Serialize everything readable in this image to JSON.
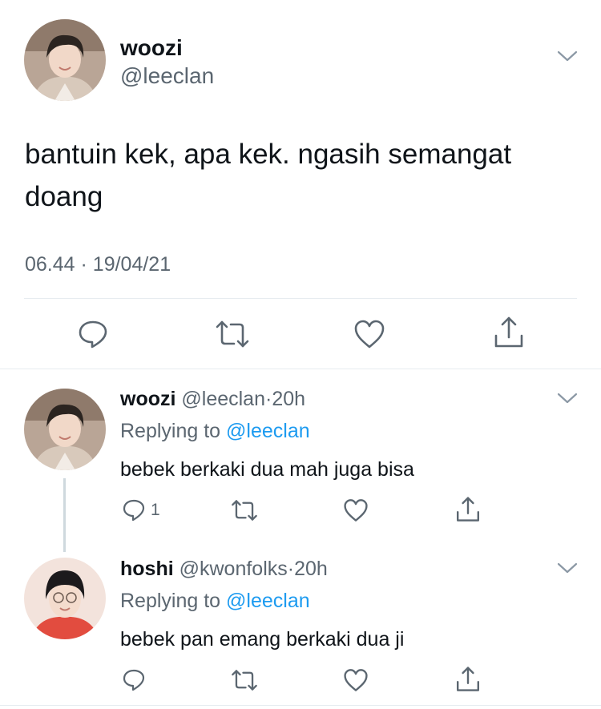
{
  "main_tweet": {
    "name": "woozi",
    "handle": "@leeclan",
    "text": "bantuin kek, apa kek. ngasih semangat doang",
    "time": "06.44",
    "separator": "·",
    "date": "19/04/21",
    "icons": [
      "avatar",
      "chevron-down-icon",
      "reply-icon",
      "retweet-icon",
      "like-icon",
      "share-icon"
    ]
  },
  "replies": [
    {
      "name": "woozi",
      "handle": "@leeclan",
      "separator": "·",
      "time": "20h",
      "replying_prefix": "Replying to",
      "replying_to": "@leeclan",
      "text": "bebek berkaki dua mah juga bisa",
      "reply_count": "1"
    },
    {
      "name": "hoshi",
      "handle": "@kwonfolks",
      "separator": "·",
      "time": "20h",
      "replying_prefix": "Replying to",
      "replying_to": "@leeclan",
      "text": "bebek pan emang berkaki dua ji",
      "reply_count": ""
    }
  ],
  "colors": {
    "text": "#0f1419",
    "secondary": "#5b6670",
    "mention": "#1d9bf0",
    "divider": "#e6ecf0"
  }
}
